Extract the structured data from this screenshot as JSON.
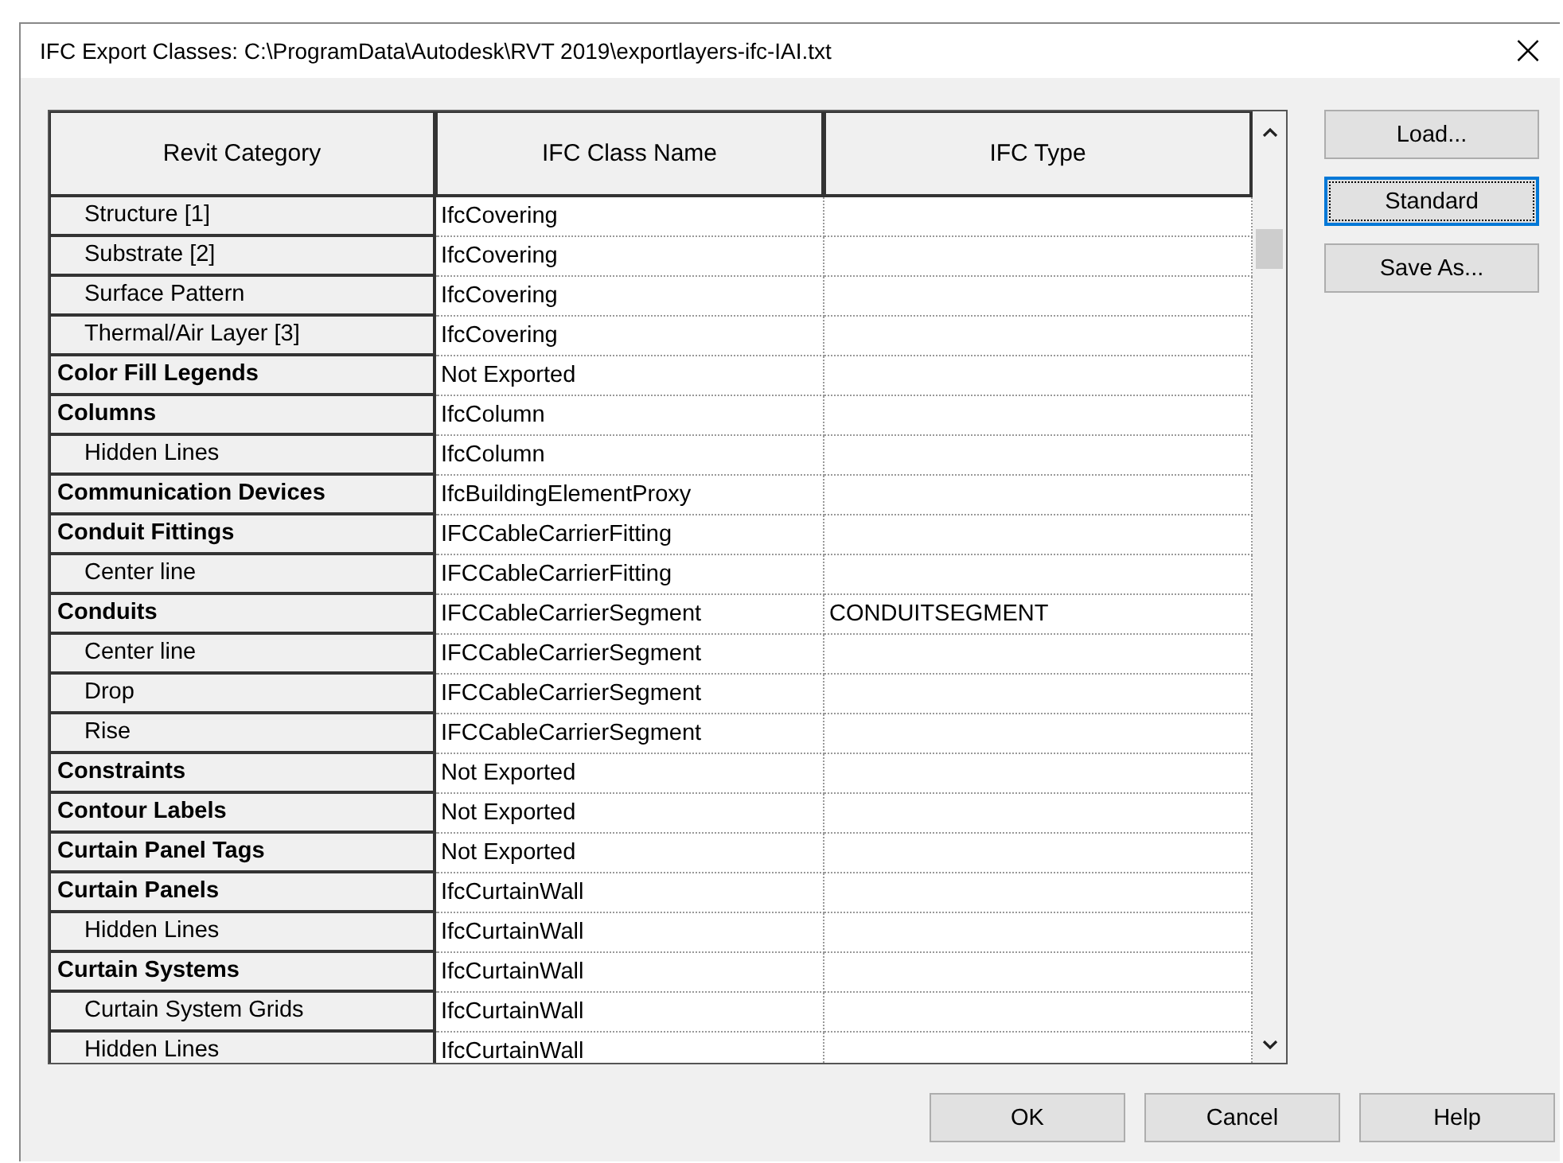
{
  "window": {
    "title": "IFC Export Classes: C:\\ProgramData\\Autodesk\\RVT 2019\\exportlayers-ifc-IAI.txt",
    "close": "×"
  },
  "table": {
    "columns": [
      "Revit Category",
      "IFC Class Name",
      "IFC Type"
    ],
    "rows": [
      {
        "kind": "sub",
        "category": "Structure [1]",
        "class": "IfcCovering",
        "type": ""
      },
      {
        "kind": "sub",
        "category": "Substrate [2]",
        "class": "IfcCovering",
        "type": ""
      },
      {
        "kind": "sub",
        "category": "Surface Pattern",
        "class": "IfcCovering",
        "type": ""
      },
      {
        "kind": "sub",
        "category": "Thermal/Air Layer [3]",
        "class": "IfcCovering",
        "type": ""
      },
      {
        "kind": "main",
        "category": "Color Fill Legends",
        "class": "Not Exported",
        "type": ""
      },
      {
        "kind": "main",
        "category": "Columns",
        "class": "IfcColumn",
        "type": ""
      },
      {
        "kind": "sub",
        "category": "Hidden Lines",
        "class": "IfcColumn",
        "type": ""
      },
      {
        "kind": "main",
        "category": "Communication Devices",
        "class": "IfcBuildingElementProxy",
        "type": ""
      },
      {
        "kind": "main",
        "category": "Conduit Fittings",
        "class": "IFCCableCarrierFitting",
        "type": ""
      },
      {
        "kind": "sub",
        "category": "Center line",
        "class": "IFCCableCarrierFitting",
        "type": ""
      },
      {
        "kind": "main",
        "category": "Conduits",
        "class": "IFCCableCarrierSegment",
        "type": "CONDUITSEGMENT"
      },
      {
        "kind": "sub",
        "category": "Center line",
        "class": "IFCCableCarrierSegment",
        "type": ""
      },
      {
        "kind": "sub",
        "category": "Drop",
        "class": "IFCCableCarrierSegment",
        "type": ""
      },
      {
        "kind": "sub",
        "category": "Rise",
        "class": "IFCCableCarrierSegment",
        "type": ""
      },
      {
        "kind": "main",
        "category": "Constraints",
        "class": "Not Exported",
        "type": ""
      },
      {
        "kind": "main",
        "category": "Contour Labels",
        "class": "Not Exported",
        "type": ""
      },
      {
        "kind": "main",
        "category": "Curtain Panel Tags",
        "class": "Not Exported",
        "type": ""
      },
      {
        "kind": "main",
        "category": "Curtain Panels",
        "class": "IfcCurtainWall",
        "type": ""
      },
      {
        "kind": "sub",
        "category": "Hidden Lines",
        "class": "IfcCurtainWall",
        "type": ""
      },
      {
        "kind": "main",
        "category": "Curtain Systems",
        "class": "IfcCurtainWall",
        "type": ""
      },
      {
        "kind": "sub",
        "category": "Curtain System Grids",
        "class": "IfcCurtainWall",
        "type": ""
      },
      {
        "kind": "sub",
        "category": "Hidden Lines",
        "class": "IfcCurtainWall",
        "type": ""
      }
    ]
  },
  "side_buttons": [
    {
      "label": "Load...",
      "focused": false
    },
    {
      "label": "Standard",
      "focused": true
    },
    {
      "label": "Save As...",
      "focused": false
    }
  ],
  "buttons": [
    "OK",
    "Cancel",
    "Help"
  ]
}
